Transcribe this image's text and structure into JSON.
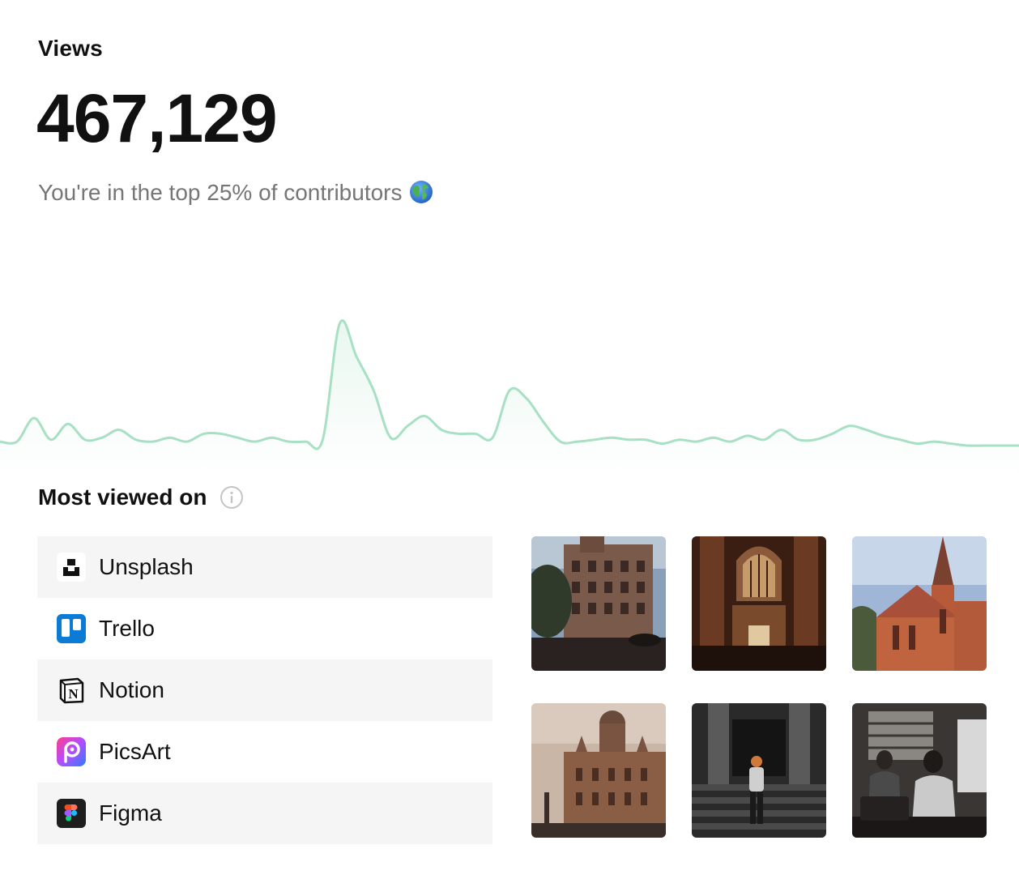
{
  "header": {
    "title": "Views",
    "views_count": "467,129",
    "subtitle": "You're in the top 25% of contributors"
  },
  "icons": {
    "globe": "globe-icon",
    "info": "info-icon"
  },
  "colors": {
    "chart_line": "#a8e0c4",
    "row_shade": "#f5f5f5",
    "subtitle_text": "#767676"
  },
  "chart_data": {
    "type": "area",
    "x": [
      0,
      1,
      2,
      3,
      4,
      5,
      6,
      7,
      8,
      9,
      10,
      11,
      12,
      13,
      14,
      15,
      16,
      17,
      18,
      19,
      20,
      21,
      22,
      23,
      24,
      25,
      26,
      27,
      28,
      29,
      30,
      31,
      32,
      33,
      34,
      35,
      36,
      37,
      38,
      39,
      40,
      41,
      42,
      43,
      44,
      45,
      46,
      47,
      48,
      49,
      50,
      51,
      52,
      53,
      54,
      55,
      56,
      57,
      58,
      59,
      60
    ],
    "values": [
      2,
      2,
      14,
      3,
      11,
      3,
      4,
      8,
      3,
      2,
      4,
      2,
      6,
      6,
      4,
      2,
      4,
      2,
      2,
      3,
      62,
      45,
      28,
      4,
      10,
      15,
      8,
      6,
      6,
      4,
      28,
      24,
      12,
      2,
      2,
      3,
      4,
      3,
      3,
      1,
      3,
      2,
      4,
      2,
      5,
      3,
      8,
      3,
      3,
      6,
      10,
      8,
      5,
      3,
      1,
      2,
      1,
      0,
      0,
      0,
      0
    ],
    "grid": false,
    "legend": "none",
    "ylim": [
      0,
      70
    ]
  },
  "most_viewed": {
    "title": "Most viewed on",
    "apps": [
      {
        "name": "Unsplash",
        "icon": "unsplash-icon"
      },
      {
        "name": "Trello",
        "icon": "trello-icon"
      },
      {
        "name": "Notion",
        "icon": "notion-icon"
      },
      {
        "name": "PicsArt",
        "icon": "picsart-icon"
      },
      {
        "name": "Figma",
        "icon": "figma-icon"
      }
    ]
  },
  "photos": [
    {
      "subject": "colonial-building-street-photo"
    },
    {
      "subject": "cathedral-interior-photo"
    },
    {
      "subject": "church-spire-photo"
    },
    {
      "subject": "domed-heritage-building-photo"
    },
    {
      "subject": "person-on-stairs-photo"
    },
    {
      "subject": "train-passengers-photo"
    }
  ]
}
